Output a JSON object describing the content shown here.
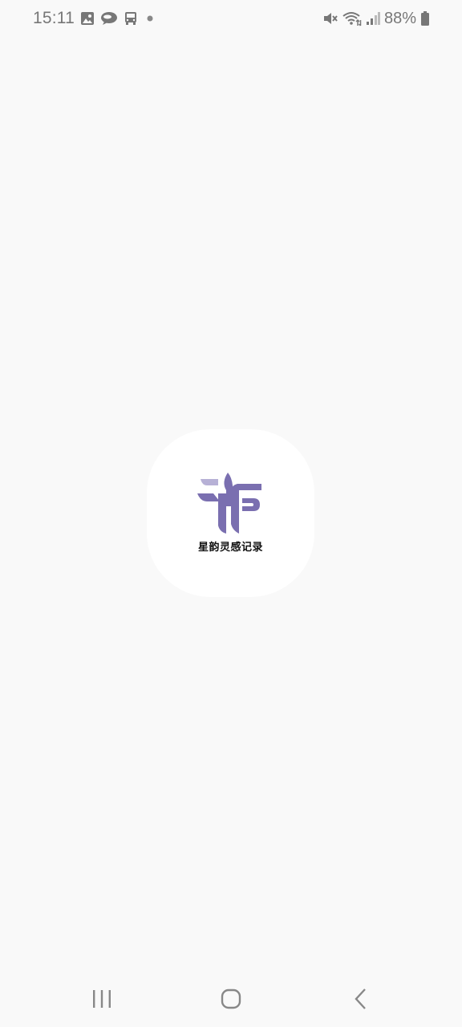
{
  "status_bar": {
    "time": "15:11",
    "battery_percent": "88%",
    "left_icons": [
      "image-icon",
      "cloud-chat-icon",
      "bus-icon",
      "dot-icon"
    ],
    "right_icons": [
      "mute-icon",
      "wifi-icon",
      "signal-icon",
      "battery-icon"
    ]
  },
  "splash": {
    "app_name": "星韵灵感记录",
    "logo_color": "#7a6fb0"
  },
  "nav_bar": {
    "buttons": [
      "recent-apps-icon",
      "home-icon",
      "back-icon"
    ]
  }
}
